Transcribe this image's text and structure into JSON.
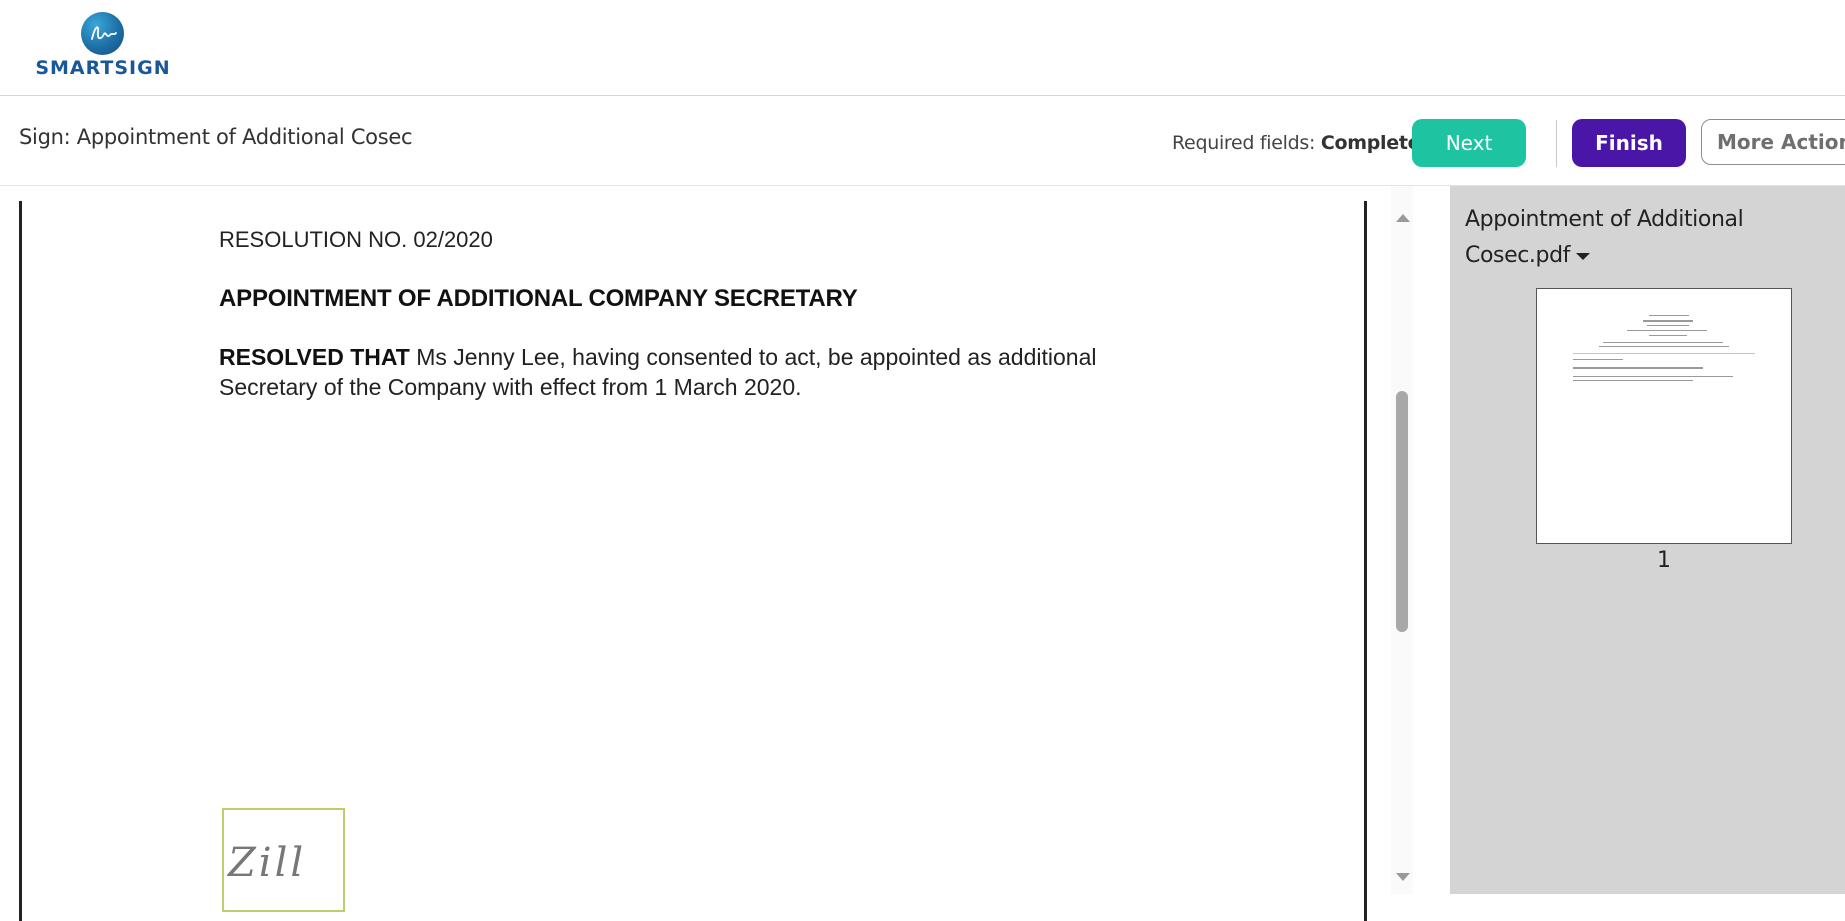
{
  "brand": {
    "name": "SMARTSIGN",
    "icon": "signature-logo-icon",
    "color": "#17579a"
  },
  "header": {
    "title": "Sign: Appointment of Additional Cosec",
    "required_label": "Required fields:",
    "required_status": "Completed",
    "next_label": "Next",
    "finish_label": "Finish",
    "more_actions_label": "More Actions",
    "colors": {
      "next": "#1ec4a2",
      "finish": "#4a16a8"
    }
  },
  "document": {
    "resolution_no": "RESOLUTION NO. 02/2020",
    "heading": "APPOINTMENT OF ADDITIONAL COMPANY SECRETARY",
    "resolved_label": "RESOLVED THAT",
    "resolved_text": " Ms Jenny Lee, having consented to act, be appointed as additional Secretary of the Company with effect from 1 March 2020.",
    "signature_field": {
      "icon": "signature-field-icon"
    }
  },
  "side_panel": {
    "file_name": "Appointment of Additional Cosec.pdf",
    "pages": [
      {
        "number": "1"
      }
    ]
  }
}
